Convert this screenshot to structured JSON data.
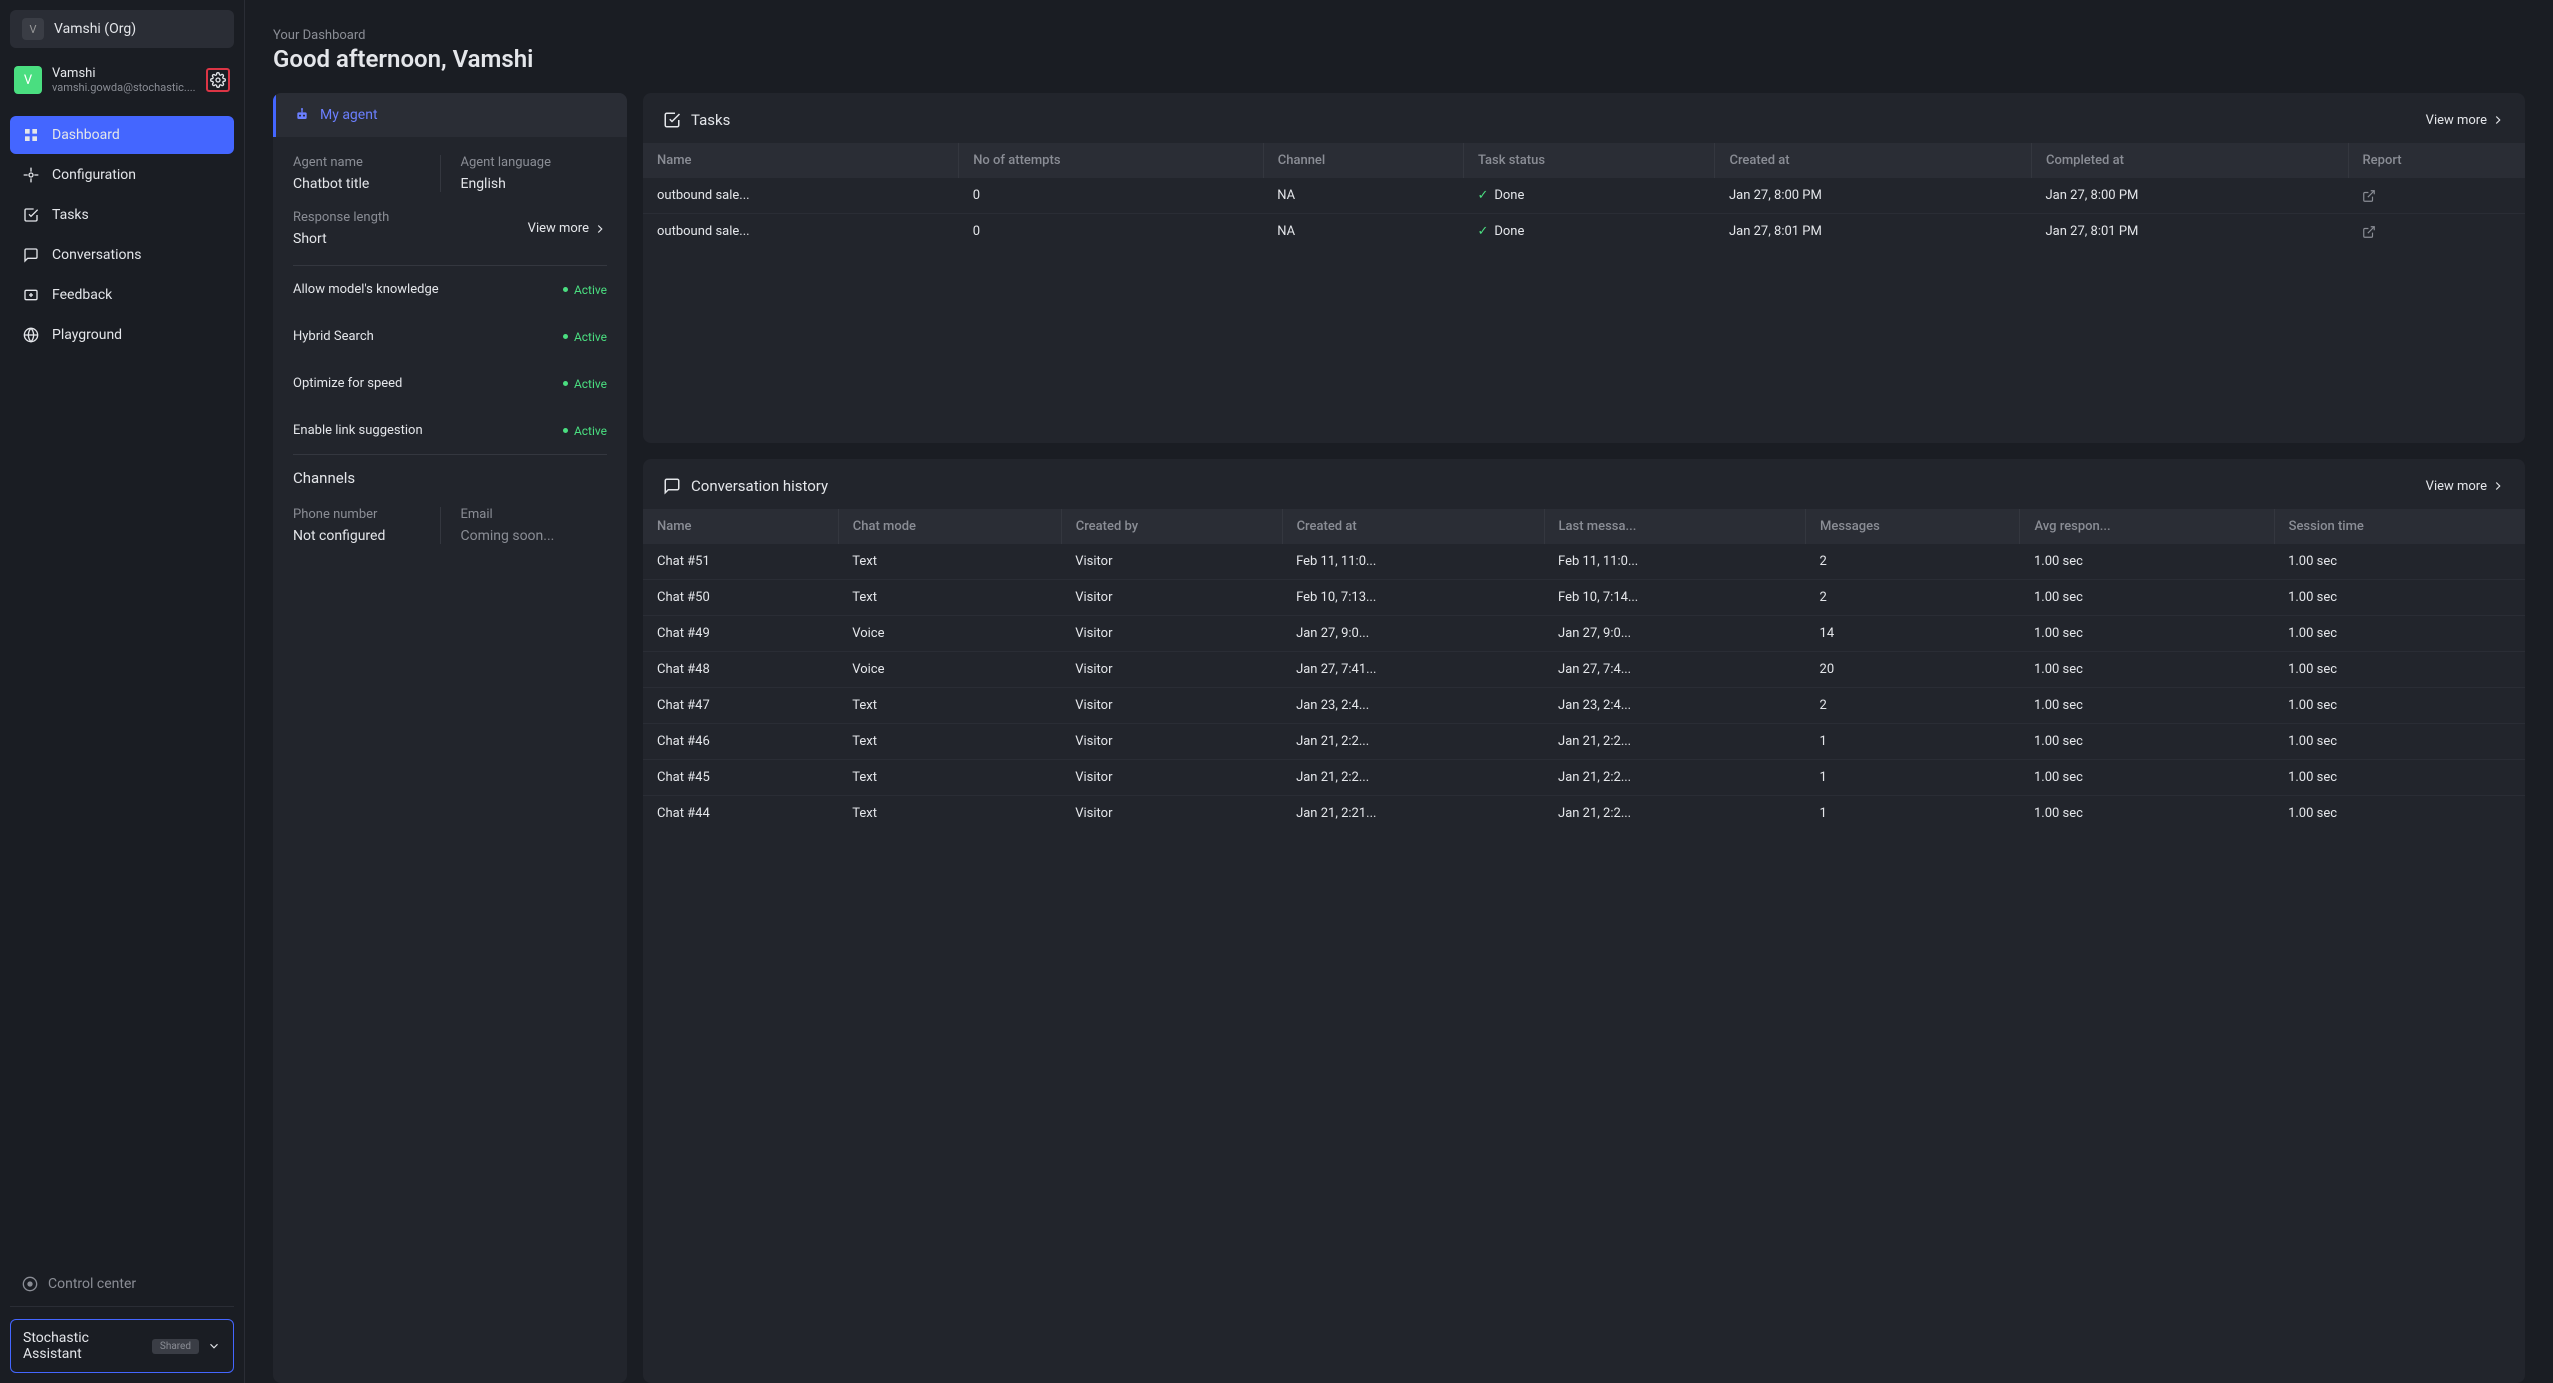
{
  "sidebar": {
    "org": {
      "initial": "V",
      "name": "Vamshi (Org)"
    },
    "user": {
      "initial": "V",
      "name": "Vamshi",
      "email": "vamshi.gowda@stochastic...."
    },
    "nav": [
      {
        "label": "Dashboard",
        "active": true
      },
      {
        "label": "Configuration"
      },
      {
        "label": "Tasks"
      },
      {
        "label": "Conversations"
      },
      {
        "label": "Feedback"
      },
      {
        "label": "Playground"
      }
    ],
    "control_center": "Control center",
    "assistant": {
      "name": "Stochastic Assistant",
      "badge": "Shared"
    }
  },
  "header": {
    "eyebrow": "Your Dashboard",
    "title": "Good afternoon, Vamshi"
  },
  "my_agent": {
    "tab_label": "My agent",
    "agent_name_label": "Agent name",
    "agent_name": "Chatbot title",
    "agent_lang_label": "Agent language",
    "agent_lang": "English",
    "response_length_label": "Response length",
    "response_length": "Short",
    "view_more": "View more",
    "features": [
      {
        "name": "Allow model's knowledge",
        "status": "Active"
      },
      {
        "name": "Hybrid Search",
        "status": "Active"
      },
      {
        "name": "Optimize for speed",
        "status": "Active"
      },
      {
        "name": "Enable link suggestion",
        "status": "Active"
      }
    ],
    "channels_label": "Channels",
    "phone_label": "Phone number",
    "phone_value": "Not configured",
    "email_label": "Email",
    "email_value": "Coming soon..."
  },
  "tasks": {
    "title": "Tasks",
    "view_more": "View more",
    "columns": [
      "Name",
      "No of attempts",
      "Channel",
      "Task status",
      "Created at",
      "Completed at",
      "Report"
    ],
    "rows": [
      {
        "name": "outbound sale...",
        "attempts": "0",
        "channel": "NA",
        "status": "Done",
        "created": "Jan 27, 8:00 PM",
        "completed": "Jan 27, 8:00 PM"
      },
      {
        "name": "outbound sale...",
        "attempts": "0",
        "channel": "NA",
        "status": "Done",
        "created": "Jan 27, 8:01 PM",
        "completed": "Jan 27, 8:01 PM"
      }
    ]
  },
  "conversations": {
    "title": "Conversation history",
    "view_more": "View more",
    "columns": [
      "Name",
      "Chat mode",
      "Created by",
      "Created at",
      "Last messa...",
      "Messages",
      "Avg respon...",
      "Session time"
    ],
    "rows": [
      {
        "name": "Chat #51",
        "mode": "Text",
        "by": "Visitor",
        "created": "Feb 11, 11:0...",
        "last": "Feb 11, 11:0...",
        "msgs": "2",
        "avg": "1.00 sec",
        "session": "1.00 sec"
      },
      {
        "name": "Chat #50",
        "mode": "Text",
        "by": "Visitor",
        "created": "Feb 10, 7:13...",
        "last": "Feb 10, 7:14...",
        "msgs": "2",
        "avg": "1.00 sec",
        "session": "1.00 sec"
      },
      {
        "name": "Chat #49",
        "mode": "Voice",
        "by": "Visitor",
        "created": "Jan 27, 9:0...",
        "last": "Jan 27, 9:0...",
        "msgs": "14",
        "avg": "1.00 sec",
        "session": "1.00 sec"
      },
      {
        "name": "Chat #48",
        "mode": "Voice",
        "by": "Visitor",
        "created": "Jan 27, 7:41...",
        "last": "Jan 27, 7:4...",
        "msgs": "20",
        "avg": "1.00 sec",
        "session": "1.00 sec"
      },
      {
        "name": "Chat #47",
        "mode": "Text",
        "by": "Visitor",
        "created": "Jan 23, 2:4...",
        "last": "Jan 23, 2:4...",
        "msgs": "2",
        "avg": "1.00 sec",
        "session": "1.00 sec"
      },
      {
        "name": "Chat #46",
        "mode": "Text",
        "by": "Visitor",
        "created": "Jan 21, 2:2...",
        "last": "Jan 21, 2:2...",
        "msgs": "1",
        "avg": "1.00 sec",
        "session": "1.00 sec"
      },
      {
        "name": "Chat #45",
        "mode": "Text",
        "by": "Visitor",
        "created": "Jan 21, 2:2...",
        "last": "Jan 21, 2:2...",
        "msgs": "1",
        "avg": "1.00 sec",
        "session": "1.00 sec"
      },
      {
        "name": "Chat #44",
        "mode": "Text",
        "by": "Visitor",
        "created": "Jan 21, 2:21...",
        "last": "Jan 21, 2:2...",
        "msgs": "1",
        "avg": "1.00 sec",
        "session": "1.00 sec"
      }
    ]
  }
}
